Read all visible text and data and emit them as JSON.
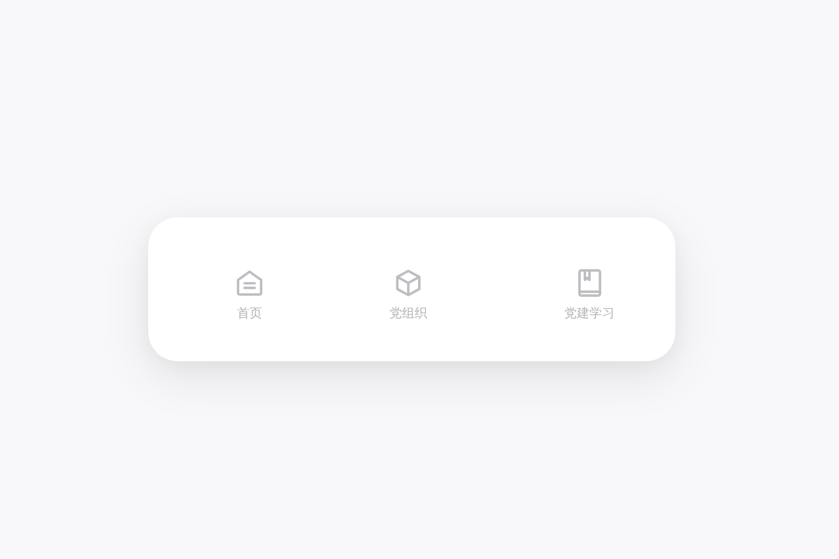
{
  "tab_bar": {
    "tabs": [
      {
        "label": "首页",
        "selected": false
      },
      {
        "label": "党组织",
        "selected": false
      },
      {
        "label": "党建学习",
        "selected": false
      }
    ]
  }
}
